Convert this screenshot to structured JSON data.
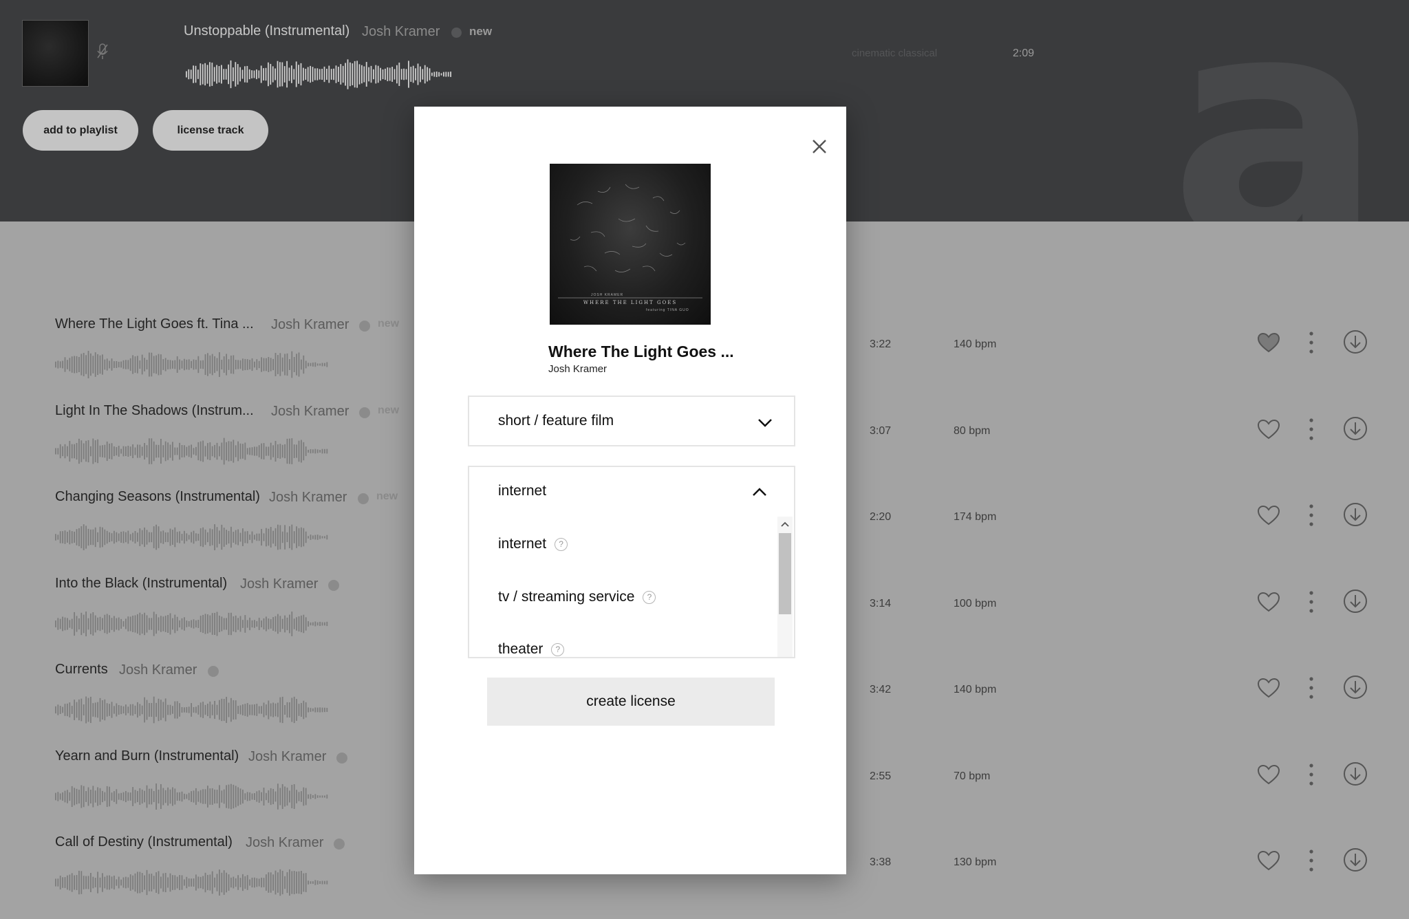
{
  "now_playing": {
    "title": "Unstoppable (Instrumental)",
    "artist": "Josh Kramer",
    "badge": "new",
    "tags": "cinematic   classical",
    "duration": "2:09",
    "bg_letter": "a."
  },
  "actions": {
    "add_to_playlist": "add to playlist",
    "license_track": "license track"
  },
  "tracks": [
    {
      "title": "Where The Light Goes ft. Tina ...",
      "artist": "Josh Kramer",
      "badge": "new",
      "duration": "3:22",
      "bpm": "140 bpm",
      "liked": true
    },
    {
      "title": "Light In The Shadows (Instrum...",
      "artist": "Josh Kramer",
      "badge": "new",
      "duration": "3:07",
      "bpm": "80 bpm",
      "liked": false
    },
    {
      "title": "Changing Seasons (Instrumental)",
      "artist": "Josh Kramer",
      "badge": "new",
      "duration": "2:20",
      "bpm": "174 bpm",
      "liked": false
    },
    {
      "title": "Into the Black (Instrumental)",
      "artist": "Josh Kramer",
      "badge": "",
      "duration": "3:14",
      "bpm": "100 bpm",
      "liked": false
    },
    {
      "title": "Currents",
      "artist": "Josh Kramer",
      "badge": "",
      "duration": "3:42",
      "bpm": "140 bpm",
      "liked": false
    },
    {
      "title": "Yearn and Burn (Instrumental)",
      "artist": "Josh Kramer",
      "badge": "",
      "duration": "2:55",
      "bpm": "70 bpm",
      "liked": false
    },
    {
      "title": "Call of Destiny (Instrumental)",
      "artist": "Josh Kramer",
      "badge": "",
      "duration": "3:38",
      "bpm": "130 bpm",
      "liked": false
    }
  ],
  "modal": {
    "cover_artist": "JOSH KRAMER",
    "cover_title": "WHERE THE LIGHT GOES",
    "cover_feat": "featuring TINA GUO",
    "track_title": "Where The Light Goes ...",
    "track_artist": "Josh Kramer",
    "project_type": "short / feature film",
    "media_selected": "internet",
    "media_options": [
      "internet",
      "tv / streaming service",
      "theater"
    ],
    "create_button": "create license"
  },
  "icons": {
    "close": "close-icon",
    "heart": "heart-icon",
    "more": "more-vertical-icon",
    "download": "download-icon",
    "help": "help-icon",
    "chevron_down": "chevron-down-icon",
    "chevron_up": "chevron-up-icon",
    "mic_off": "mic-off-icon",
    "verified": "verified-icon"
  },
  "colors": {
    "header_bg": "#3a3b3d",
    "page_bg": "#a3a3a3",
    "modal_bg": "#ffffff",
    "button_bg": "#ebebeb"
  }
}
